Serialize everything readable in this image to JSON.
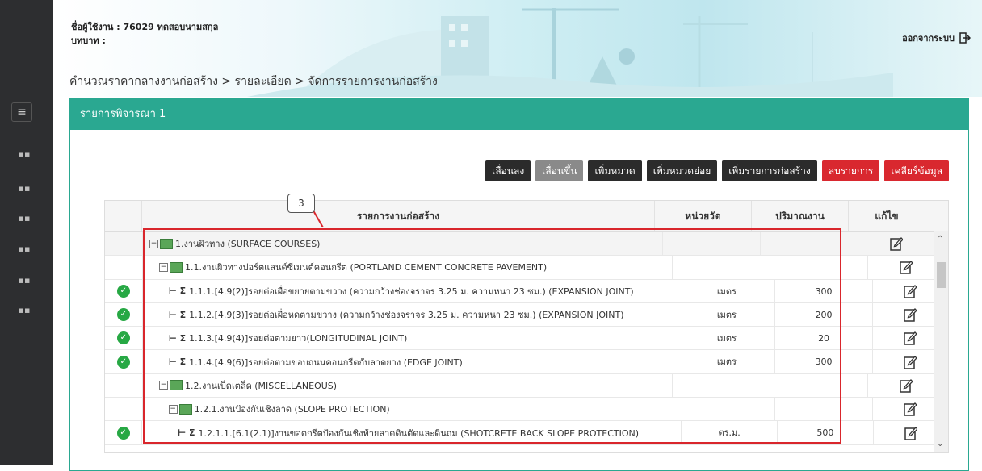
{
  "header": {
    "user_label": "ชื่อผู้ใช้งาน : 76029 ทดสอบนามสกุล",
    "role_label": "บทบาท :",
    "logout_label": "ออกจากระบบ",
    "breadcrumb": "คำนวณราคากลางงานก่อสร้าง > รายละเอียด > จัดการรายการงานก่อสร้าง"
  },
  "panel": {
    "title": "รายการพิจารณา 1"
  },
  "toolbar": {
    "move_down": "เลื่อนลง",
    "move_up": "เลื่อนขึ้น",
    "add_category": "เพิ่มหมวด",
    "add_subcategory": "เพิ่มหมวดย่อย",
    "add_item": "เพิ่มรายการก่อสร้าง",
    "delete_item": "ลบรายการ",
    "clear_data": "เคลียร์ข้อมูล"
  },
  "table": {
    "headers": {
      "name": "รายการงานก่อสร้าง",
      "unit": "หน่วยวัด",
      "qty": "ปริมาณงาน",
      "edit": "แก้ไข"
    },
    "rows": [
      {
        "status": false,
        "name": "1.งานผิวทาง (SURFACE COURSES)",
        "unit": "",
        "qty": ""
      },
      {
        "status": false,
        "name": "1.1.งานผิวทางปอร์ตแลนด์ซีเมนต์คอนกรีต (PORTLAND CEMENT CONCRETE PAVEMENT)",
        "unit": "",
        "qty": ""
      },
      {
        "status": true,
        "name": "1.1.1.[4.9(2)]รอยต่อเผื่อขยายตามขวาง (ความกว้างช่องจราจร 3.25 ม. ความหนา 23 ซม.) (EXPANSION JOINT)",
        "unit": "เมตร",
        "qty": "300"
      },
      {
        "status": true,
        "name": "1.1.2.[4.9(3)]รอยต่อเผื่อหดตามขวาง (ความกว้างช่องจราจร 3.25 ม. ความหนา 23 ซม.) (EXPANSION JOINT)",
        "unit": "เมตร",
        "qty": "200"
      },
      {
        "status": true,
        "name": "1.1.3.[4.9(4)]รอยต่อตามยาว(LONGITUDINAL JOINT)",
        "unit": "เมตร",
        "qty": "20"
      },
      {
        "status": true,
        "name": "1.1.4.[4.9(6)]รอยต่อตามขอบถนนคอนกรีตกับลาดยาง (EDGE JOINT)",
        "unit": "เมตร",
        "qty": "300"
      },
      {
        "status": false,
        "name": "1.2.งานเบ็ดเตล็ด (MISCELLANEOUS)",
        "unit": "",
        "qty": ""
      },
      {
        "status": false,
        "name": "1.2.1.งานป้องกันเชิงลาด (SLOPE PROTECTION)",
        "unit": "",
        "qty": ""
      },
      {
        "status": true,
        "name": "1.2.1.1.[6.1(2.1)]งานขอตกรีตป้องกันเชิงท้ายลาดดินตัดและดินถม (SHOTCRETE BACK SLOPE PROTECTION)",
        "unit": "ตร.ม.",
        "qty": "500"
      }
    ]
  },
  "annotation": {
    "callout_number": "3"
  }
}
